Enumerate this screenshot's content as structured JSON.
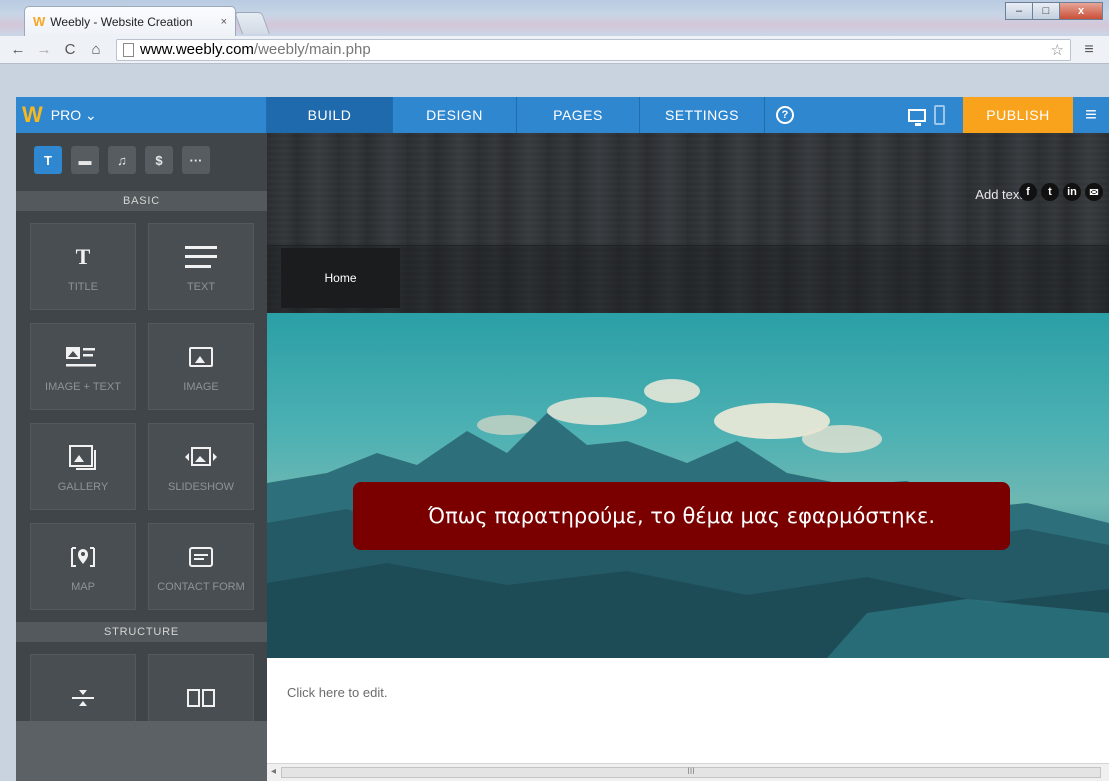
{
  "browser": {
    "tab_title": "Weebly - Website Creation",
    "tab_close": "×",
    "favicon": "W",
    "url_host": "www.weebly.com",
    "url_path": "/weebly/main.php",
    "window_controls": {
      "minimize": "–",
      "maximize": "□",
      "close": "x"
    },
    "nav": {
      "back": "←",
      "forward": "→",
      "reload": "C",
      "home": "⌂",
      "star": "☆",
      "menu": "≡"
    }
  },
  "toolbar": {
    "logo": "W",
    "plan_label": "PRO ⌄",
    "tabs": [
      {
        "label": "BUILD",
        "active": true
      },
      {
        "label": "DESIGN",
        "active": false
      },
      {
        "label": "PAGES",
        "active": false
      },
      {
        "label": "SETTINGS",
        "active": false
      }
    ],
    "help": "?",
    "publish": "PUBLISH",
    "menu": "≡",
    "colors": {
      "bar": "#2f87d0",
      "active_tab": "#1e6aac",
      "publish": "#f9a21b"
    }
  },
  "sidebar": {
    "category_tabs": [
      "T",
      "▬",
      "♫",
      "$",
      "···"
    ],
    "sections": {
      "basic": "BASIC",
      "structure": "STRUCTURE"
    },
    "elements": [
      {
        "label": "TITLE",
        "icon": "title-icon",
        "glyph": "T"
      },
      {
        "label": "TEXT",
        "icon": "text-lines-icon"
      },
      {
        "label": "IMAGE + TEXT",
        "icon": "image-text-icon"
      },
      {
        "label": "IMAGE",
        "icon": "image-icon"
      },
      {
        "label": "GALLERY",
        "icon": "gallery-icon"
      },
      {
        "label": "SLIDESHOW",
        "icon": "slideshow-icon"
      },
      {
        "label": "MAP",
        "icon": "map-pin-icon"
      },
      {
        "label": "CONTACT FORM",
        "icon": "form-icon"
      },
      {
        "label": "",
        "icon": "divider-icon"
      },
      {
        "label": "",
        "icon": "columns-icon"
      }
    ]
  },
  "site": {
    "add_text": "Add text",
    "socials": [
      "f",
      "t",
      "in",
      "✉"
    ],
    "nav_home": "Home",
    "content_placeholder": "Click here to edit.",
    "scroll_grip": "III"
  },
  "callout": {
    "text": "Όπως παρατηρούμε, το θέμα μας εφαρμόστηκε.",
    "color": "#7a0000"
  }
}
